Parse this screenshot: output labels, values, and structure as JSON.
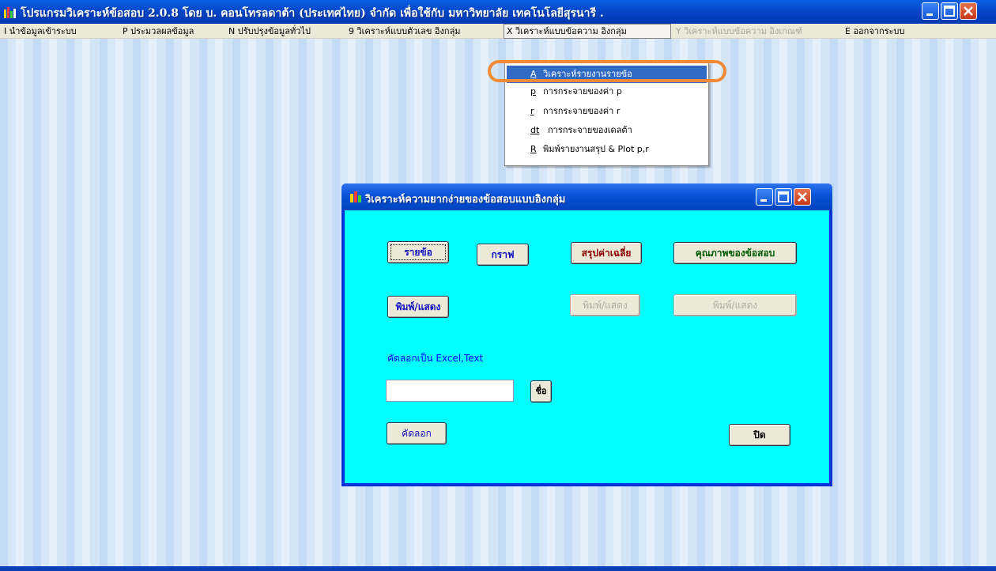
{
  "window": {
    "title": "โปรแกรมวิเคราะห์ข้อสอบ 2.0.8  โดย บ. คอนโทรลดาต้า (ประเทศไทย) จำกัด เพื่อใช้กับ  มหาวิทยาลัย เทคโนโลยีสุรนารี ."
  },
  "menu": {
    "items": [
      {
        "label": "I นำข้อมูลเข้าระบบ"
      },
      {
        "label": "P ประมวลผลข้อมูล"
      },
      {
        "label": "N ปรับปรุงข้อมูลทั่วไป"
      },
      {
        "label": "9  วิเคราะห์แบบตัวเลข อิงกลุ่ม"
      },
      {
        "label": "X  วิเคราะห์แบบข้อความ อิงกลุ่ม"
      },
      {
        "label": "Y  วิเคราะห์แบบข้อความ อิงเกณฑ์"
      },
      {
        "label": "E ออกจากระบบ"
      }
    ]
  },
  "dropdown": {
    "items": [
      {
        "key": "A",
        "label": "วิเคราะห์รายงานรายข้อ"
      },
      {
        "key": "p",
        "label": "การกระจายของค่า p"
      },
      {
        "key": "r",
        "label": "การกระจายของค่า r"
      },
      {
        "key": "dt",
        "label": "การกระจายของเดลต้า"
      },
      {
        "key": "R",
        "label": "พิมพ์รายงานสรุป & Plot p,r"
      }
    ]
  },
  "dialog": {
    "title": "วิเคราะห์ความยากง่ายของข้อสอบแบบอิงกลุ่ม",
    "buttons": {
      "by_item": "รายข้อ",
      "graph": "กราฟ",
      "summary_avg": "สรุปค่าเฉลี่ย",
      "quality": "คุณภาพของข้อสอบ",
      "print_show_1": "พิมพ์/แสดง",
      "print_show_2": "พิมพ์/แสดง",
      "print_show_3": "พิมพ์/แสดง",
      "name": "ชื่อ",
      "copy": "คัดลอก",
      "close": "ปิด"
    },
    "copy_label": "คัดลอกเป็น Excel,Text",
    "filename_value": ""
  },
  "colors": {
    "dialog_client": "#00ffff",
    "menu_highlight": "#316ac5",
    "annotation_ring": "#f08a36"
  }
}
